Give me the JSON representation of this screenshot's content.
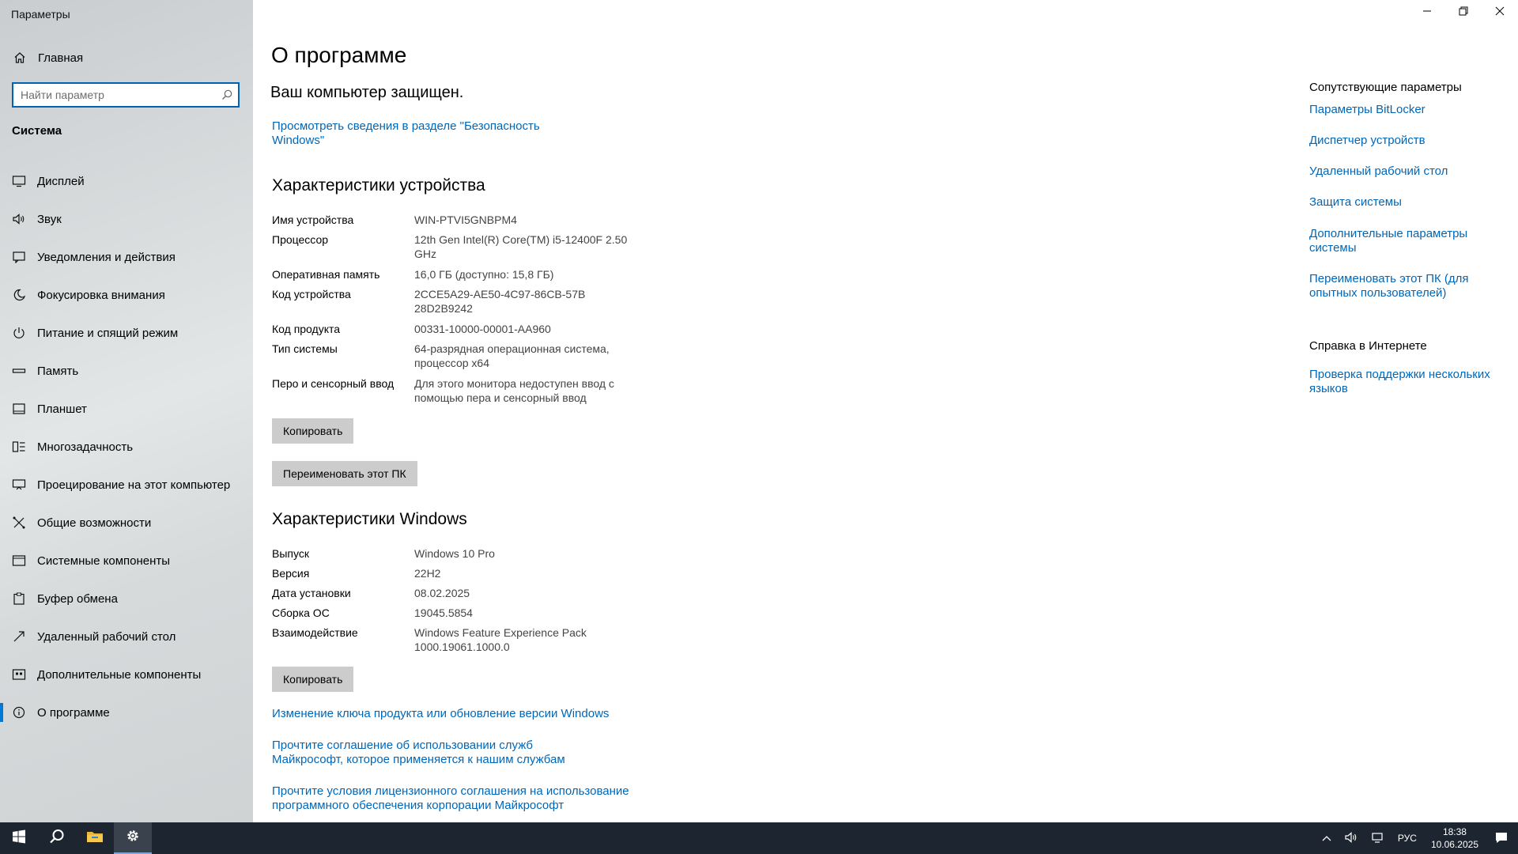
{
  "window": {
    "title": "Параметры"
  },
  "sidebar": {
    "home_label": "Главная",
    "search_placeholder": "Найти параметр",
    "section_title": "Система",
    "items": [
      {
        "label": "Дисплей",
        "icon": "display-icon"
      },
      {
        "label": "Звук",
        "icon": "speaker-icon"
      },
      {
        "label": "Уведомления и действия",
        "icon": "notification-icon"
      },
      {
        "label": "Фокусировка внимания",
        "icon": "moon-icon"
      },
      {
        "label": "Питание и спящий режим",
        "icon": "power-icon"
      },
      {
        "label": "Память",
        "icon": "storage-icon"
      },
      {
        "label": "Планшет",
        "icon": "tablet-icon"
      },
      {
        "label": "Многозадачность",
        "icon": "multitasking-icon"
      },
      {
        "label": "Проецирование на этот компьютер",
        "icon": "projection-icon"
      },
      {
        "label": "Общие возможности",
        "icon": "shared-experiences-icon"
      },
      {
        "label": "Системные компоненты",
        "icon": "system-components-icon"
      },
      {
        "label": "Буфер обмена",
        "icon": "clipboard-icon"
      },
      {
        "label": "Удаленный рабочий стол",
        "icon": "remote-desktop-icon"
      },
      {
        "label": "Дополнительные компоненты",
        "icon": "optional-features-icon"
      },
      {
        "label": "О программе",
        "icon": "info-icon",
        "active": true
      }
    ]
  },
  "main": {
    "title": "О программе",
    "protected_text": "Ваш компьютер защищен.",
    "security_link_line1": "Просмотреть сведения в разделе \"Безопасность",
    "security_link_line2": "Windows\"",
    "device_specs": {
      "heading": "Характеристики устройства",
      "rows": [
        {
          "key": "Имя устройства",
          "value": "WIN-PTVI5GNBPM4"
        },
        {
          "key": "Процессор",
          "value": "12th Gen Intel(R) Core(TM) i5-12400F   2.50 GHz"
        },
        {
          "key": "Оперативная память",
          "value": "16,0 ГБ (доступно: 15,8 ГБ)"
        },
        {
          "key": "Код устройства",
          "value": "2CCE5A29-AE50-4C97-86CB-57B28D2B9242"
        },
        {
          "key": "Код продукта",
          "value": "00331-10000-00001-AA960"
        },
        {
          "key": "Тип системы",
          "value": "64-разрядная операционная система, процессор x64"
        },
        {
          "key": "Перо и сенсорный ввод",
          "value": "Для этого монитора недоступен ввод с помощью пера и сенсорный ввод"
        }
      ],
      "copy_button": "Копировать",
      "rename_button": "Переименовать этот ПК"
    },
    "windows_specs": {
      "heading": "Характеристики Windows",
      "rows": [
        {
          "key": "Выпуск",
          "value": "Windows 10 Pro"
        },
        {
          "key": "Версия",
          "value": "22H2"
        },
        {
          "key": "Дата установки",
          "value": "08.02.2025"
        },
        {
          "key": "Сборка ОС",
          "value": "19045.5854"
        },
        {
          "key": "Взаимодействие",
          "value": "Windows Feature Experience Pack 1000.19061.1000.0"
        }
      ],
      "copy_button": "Копировать"
    },
    "links": [
      "Изменение ключа продукта или обновление версии Windows",
      "Прочтите соглашение об использовании служб Майкрософт, которое применяется к нашим службам",
      "Прочтите условия лицензионного соглашения на использование программного обеспечения корпорации Майкрософт"
    ]
  },
  "related": {
    "heading": "Сопутствующие параметры",
    "links": [
      "Параметры BitLocker",
      "Диспетчер устройств",
      "Удаленный рабочий стол",
      "Защита системы",
      "Дополнительные параметры системы",
      "Переименовать этот ПК (для опытных пользователей)"
    ],
    "help_heading": "Справка в Интернете",
    "help_links": [
      "Проверка поддержки нескольких языков"
    ]
  },
  "taskbar": {
    "language": "РУС",
    "time": "18:38",
    "date": "10.06.2025"
  },
  "colors": {
    "accent": "#0078d7",
    "link": "#0067b8",
    "taskbar": "#1d2630"
  }
}
